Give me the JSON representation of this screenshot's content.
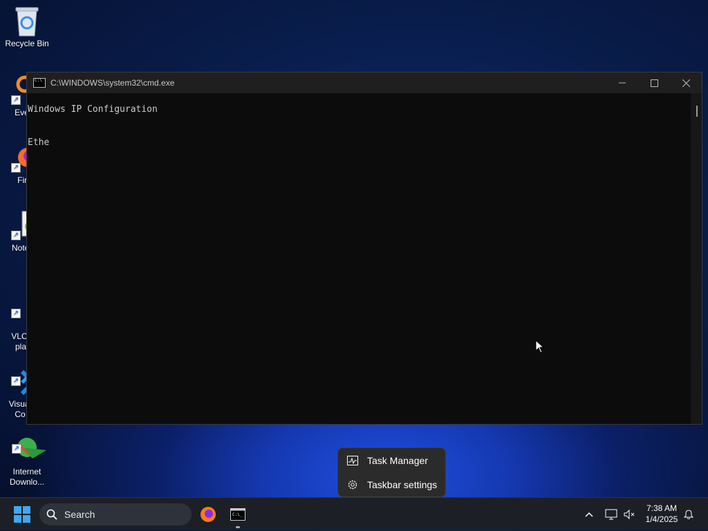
{
  "desktop": {
    "icons": [
      {
        "label": "Recycle Bin",
        "icon": "recycle-bin-icon"
      },
      {
        "label": "Every",
        "icon": "everything-search-icon"
      },
      {
        "label": "Fire",
        "icon": "firefox-icon"
      },
      {
        "label": "Notep",
        "icon": "notepad-plus-plus-icon"
      },
      {
        "label": "VLC n\nplay",
        "icon": "vlc-icon"
      },
      {
        "label": "Visual\nCo",
        "icon": "vscode-icon"
      },
      {
        "label": "Internet\nDownlo...",
        "icon": "internet-download-manager-icon"
      }
    ]
  },
  "cmd_window": {
    "title": "C:\\WINDOWS\\system32\\cmd.exe",
    "content": "Windows IP Configuration\n\n\nEthe"
  },
  "context_menu": {
    "items": [
      {
        "label": "Task Manager",
        "icon": "task-manager-icon"
      },
      {
        "label": "Taskbar settings",
        "icon": "gear-icon"
      }
    ]
  },
  "taskbar": {
    "search_label": "Search",
    "apps": [
      {
        "name": "Firefox",
        "icon": "firefox-icon"
      },
      {
        "name": "Command Prompt",
        "icon": "cmd-icon",
        "running": true
      }
    ],
    "clock": {
      "time": "7:38 AM",
      "date": "1/4/2025"
    }
  }
}
